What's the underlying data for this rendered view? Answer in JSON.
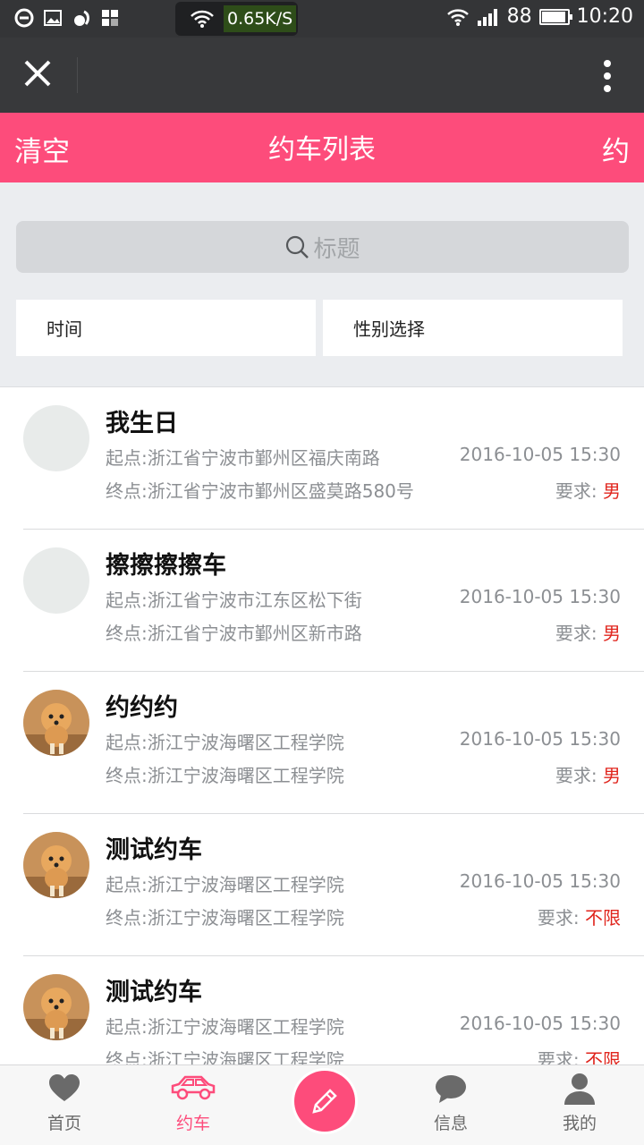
{
  "status_bar": {
    "battery": "88",
    "time": "10:20"
  },
  "app_bar": {
    "net_speed": "0.65K/S"
  },
  "header": {
    "left_label": "清空",
    "title": "约车列表",
    "right_label": "约"
  },
  "search": {
    "placeholder": "标题"
  },
  "filters": {
    "time_label": "时间",
    "gender_label": "性别选择"
  },
  "trips": [
    {
      "title": "我生日",
      "from": "起点:浙江省宁波市鄞州区福庆南路",
      "to": "终点:浙江省宁波市鄞州区盛莫路580号",
      "time": "2016-10-05 15:30",
      "req_label": "要求: ",
      "req_value": "男",
      "avatar": "blank"
    },
    {
      "title": "擦擦擦擦车",
      "from": "起点:浙江省宁波市江东区松下街",
      "to": "终点:浙江省宁波市鄞州区新市路",
      "time": "2016-10-05 15:30",
      "req_label": "要求: ",
      "req_value": "男",
      "avatar": "blank"
    },
    {
      "title": "约约约",
      "from": "起点:浙江宁波海曙区工程学院",
      "to": "终点:浙江宁波海曙区工程学院",
      "time": "2016-10-05 15:30",
      "req_label": "要求: ",
      "req_value": "男",
      "avatar": "dog"
    },
    {
      "title": "测试约车",
      "from": "起点:浙江宁波海曙区工程学院",
      "to": "终点:浙江宁波海曙区工程学院",
      "time": "2016-10-05 15:30",
      "req_label": "要求: ",
      "req_value": "不限",
      "avatar": "dog"
    },
    {
      "title": "测试约车",
      "from": "起点:浙江宁波海曙区工程学院",
      "to": "终点:浙江宁波海曙区工程学院",
      "time": "2016-10-05 15:30",
      "req_label": "要求: ",
      "req_value": "不限",
      "avatar": "dog"
    }
  ],
  "bottom_nav": {
    "items": [
      {
        "label": "首页",
        "icon": "heart-icon",
        "active": false
      },
      {
        "label": "约车",
        "icon": "car-icon",
        "active": true
      },
      {
        "label": "信息",
        "icon": "chat-bubble-icon",
        "active": false
      },
      {
        "label": "我的",
        "icon": "person-icon",
        "active": false
      }
    ],
    "fab_icon": "pencil-icon"
  },
  "colors": {
    "accent": "#fd4c7b",
    "requirement": "#e0251d",
    "status_bar": "#343537",
    "app_bar": "#38393b"
  }
}
